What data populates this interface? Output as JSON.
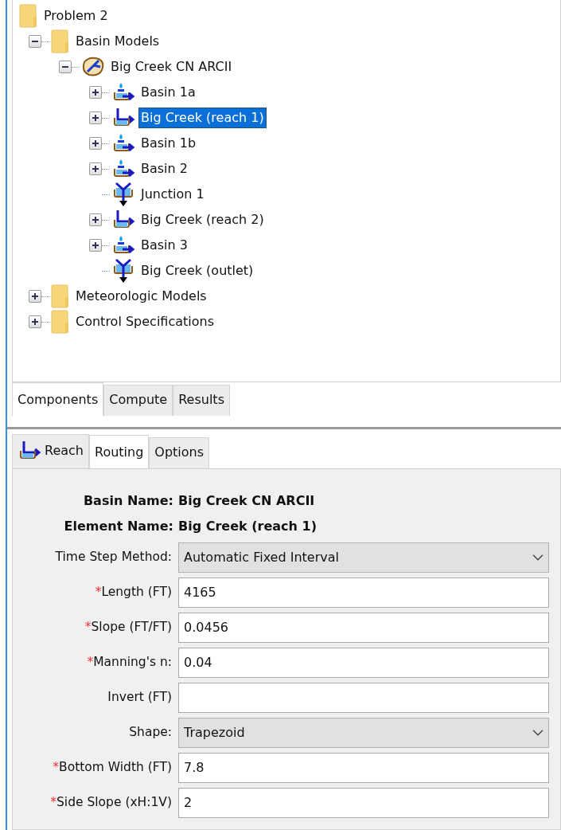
{
  "tree": [
    {
      "label": "Problem 2",
      "kind": "folder",
      "selected": false,
      "children": [
        {
          "label": "Basin Models",
          "kind": "folder",
          "expanded": true,
          "selected": false,
          "children": [
            {
              "label": "Big Creek CN ARCII",
              "kind": "basin-model",
              "expanded": true,
              "selected": false,
              "children": [
                {
                  "label": "Basin 1a",
                  "kind": "subbasin",
                  "expanded": false,
                  "selected": false
                },
                {
                  "label": "Big Creek (reach 1)",
                  "kind": "reach",
                  "expanded": false,
                  "selected": true
                },
                {
                  "label": "Basin 1b",
                  "kind": "subbasin",
                  "expanded": false,
                  "selected": false
                },
                {
                  "label": "Basin 2",
                  "kind": "subbasin",
                  "expanded": false,
                  "selected": false
                },
                {
                  "label": "Junction 1",
                  "kind": "junction",
                  "selected": false
                },
                {
                  "label": "Big Creek (reach 2)",
                  "kind": "reach",
                  "expanded": false,
                  "selected": false
                },
                {
                  "label": "Basin 3",
                  "kind": "subbasin",
                  "expanded": false,
                  "selected": false
                },
                {
                  "label": "Big Creek (outlet)",
                  "kind": "junction",
                  "selected": false
                }
              ]
            }
          ]
        },
        {
          "label": "Meteorologic Models",
          "kind": "folder",
          "expanded": false,
          "selected": false
        },
        {
          "label": "Control Specifications",
          "kind": "folder",
          "expanded": false,
          "selected": false
        }
      ]
    }
  ],
  "browser_tabs": [
    {
      "label": "Components",
      "selected": true
    },
    {
      "label": "Compute",
      "selected": false
    },
    {
      "label": "Results",
      "selected": false
    }
  ],
  "editor_tabs": [
    {
      "label": "Reach",
      "kind": "reach",
      "selected": false
    },
    {
      "label": "Routing",
      "kind": "text",
      "selected": true
    },
    {
      "label": "Options",
      "kind": "text",
      "selected": false
    }
  ],
  "header": [
    {
      "label": "Basin Name:",
      "value": "Big Creek CN ARCII"
    },
    {
      "label": "Element Name:",
      "value": "Big Creek (reach 1)"
    }
  ],
  "fields": [
    {
      "label": "Time Step Method:",
      "kind": "combo",
      "value": "Automatic Fixed Interval"
    },
    {
      "required_mark": "*",
      "label": "Length (FT)",
      "kind": "text",
      "value": "4165"
    },
    {
      "required_mark": "*",
      "label": "Slope (FT/FT)",
      "kind": "text",
      "value": "0.0456"
    },
    {
      "required_mark": "*",
      "label": "Manning's n:",
      "kind": "text",
      "value": "0.04"
    },
    {
      "label": "Invert (FT)",
      "kind": "text"
    },
    {
      "label": "Shape:",
      "kind": "combo",
      "value": "Trapezoid"
    },
    {
      "required_mark": "*",
      "label": "Bottom Width (FT)",
      "kind": "text",
      "value": "7.8"
    },
    {
      "required_mark": "*",
      "label": "Side Slope (xH:1V)",
      "kind": "text",
      "value": "2"
    }
  ]
}
